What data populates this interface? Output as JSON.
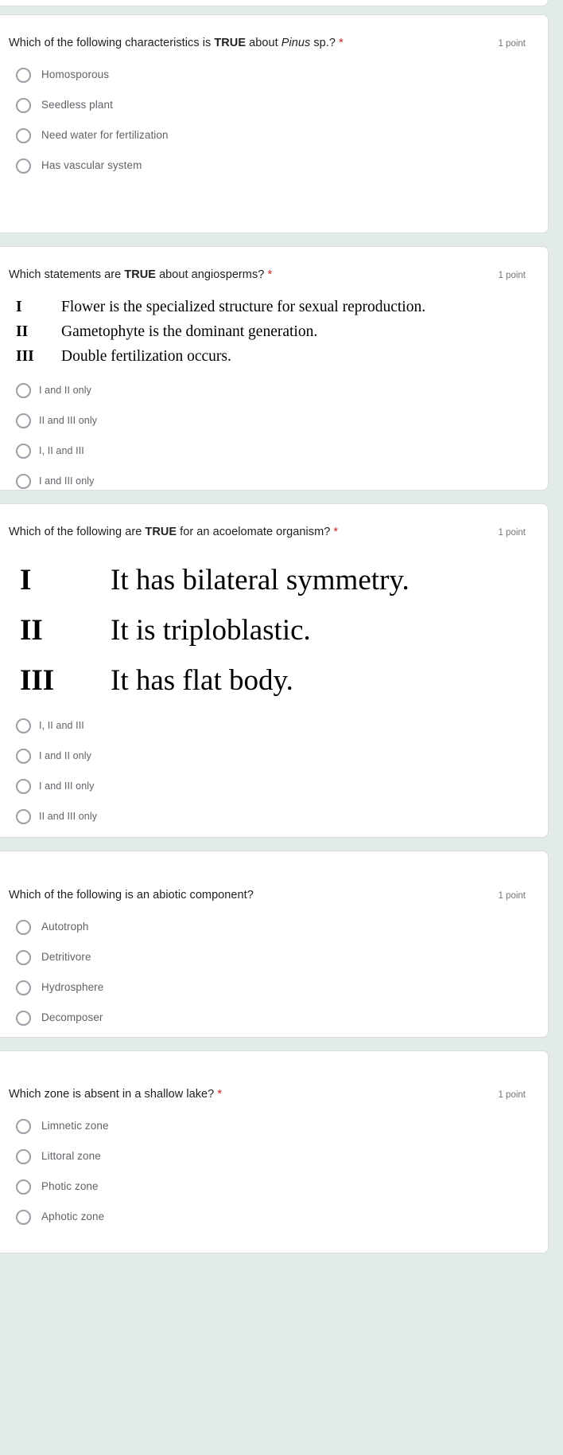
{
  "form": {
    "background_color": "#e3ebe9",
    "card_color": "#ffffff",
    "required_marker": "*",
    "required_marker_color": "#c5221f",
    "points_label": "1 point"
  },
  "questions": [
    {
      "id": "q1",
      "title_parts": {
        "p1": "Which of the following characteristics is ",
        "bold": "TRUE",
        "p2": " about ",
        "italic": "Pinus",
        "p3": " sp.?"
      },
      "required": true,
      "points": "1 point",
      "options": [
        "Homosporous",
        "Seedless plant",
        "Need water for fertilization",
        "Has vascular system"
      ]
    },
    {
      "id": "q2",
      "title_parts": {
        "p1": "Which statements are ",
        "bold": "TRUE",
        "p2": " about angiosperms?",
        "italic": "",
        "p3": ""
      },
      "required": true,
      "points": "1 point",
      "statements": [
        {
          "num": "I",
          "text": "Flower is the specialized structure for sexual reproduction."
        },
        {
          "num": "II",
          "text": "Gametophyte is the dominant generation."
        },
        {
          "num": "III",
          "text": "Double fertilization occurs."
        }
      ],
      "options": [
        "I and II only",
        "II and III only",
        "I, II and III",
        "I and III only"
      ]
    },
    {
      "id": "q3",
      "title_parts": {
        "p1": "Which of the following are ",
        "bold": "TRUE",
        "p2": " for an acoelomate organism?",
        "italic": "",
        "p3": ""
      },
      "required": true,
      "points": "1 point",
      "statements": [
        {
          "num": "I",
          "text": "It has bilateral symmetry."
        },
        {
          "num": "II",
          "text": "It is triploblastic."
        },
        {
          "num": "III",
          "text": "It has flat body."
        }
      ],
      "options": [
        "I, II and III",
        "I and II only",
        "I and III only",
        "II and III only"
      ]
    },
    {
      "id": "q4",
      "title_parts": {
        "p1": "Which of the following is an abiotic component?",
        "bold": "",
        "p2": "",
        "italic": "",
        "p3": ""
      },
      "required": false,
      "points": "1 point",
      "options": [
        "Autotroph",
        "Detritivore",
        "Hydrosphere",
        "Decomposer"
      ]
    },
    {
      "id": "q5",
      "title_parts": {
        "p1": "Which zone is absent in a shallow lake? ",
        "bold": "",
        "p2": "",
        "italic": "",
        "p3": ""
      },
      "required": true,
      "points": "1 point",
      "options": [
        "Limnetic zone",
        "Littoral zone",
        "Photic zone",
        "Aphotic zone"
      ]
    }
  ]
}
